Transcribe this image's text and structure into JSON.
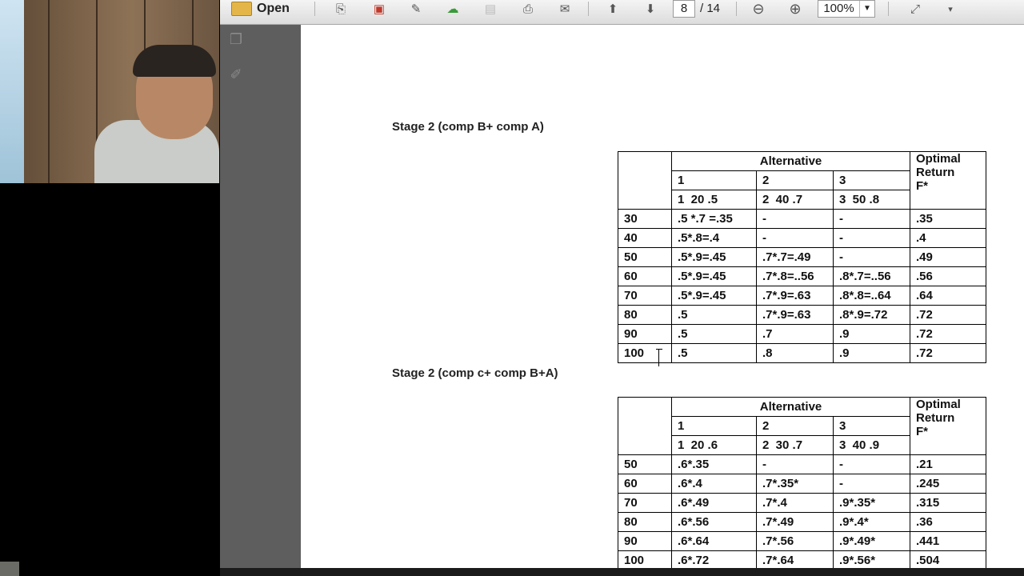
{
  "toolbar": {
    "open_label": "Open",
    "page_current": "8",
    "page_total": "/ 14",
    "zoom": "100%",
    "icons": [
      "create-pdf-icon",
      "export-icon",
      "edit-icon",
      "upload-icon",
      "save-icon",
      "print-icon",
      "email-icon",
      "page-up-icon",
      "page-down-icon",
      "zoom-out-icon",
      "zoom-in-icon",
      "fit-page-icon",
      "more-icon"
    ]
  },
  "document": {
    "stage1_title": "Stage 2 (comp B+ comp A)",
    "stage2_title": "Stage 2 (comp c+ comp B+A)",
    "table1": {
      "alt_header": "Alternative",
      "opt_header": [
        "Optimal",
        "Return",
        "F*"
      ],
      "alt_numbers": [
        "1",
        "2",
        "3"
      ],
      "alt_params": [
        "1  20 .5",
        "2  40 .7",
        "3  50 .8"
      ],
      "rows": [
        {
          "state": "30",
          "a1": ".5 *.7 =.35",
          "a2": "-",
          "a3": "-",
          "opt": ".35"
        },
        {
          "state": "40",
          "a1": ".5*.8=.4",
          "a2": "-",
          "a3": "-",
          "opt": ".4"
        },
        {
          "state": "50",
          "a1": ".5*.9=.45",
          "a2": ".7*.7=.49",
          "a3": "-",
          "opt": ".49"
        },
        {
          "state": "60",
          "a1": ".5*.9=.45",
          "a2": ".7*.8=..56",
          "a3": ".8*.7=..56",
          "opt": ".56"
        },
        {
          "state": "70",
          "a1": ".5*.9=.45",
          "a2": ".7*.9=.63",
          "a3": ".8*.8=..64",
          "opt": ".64"
        },
        {
          "state": "80",
          "a1": ".5",
          "a2": ".7*.9=.63",
          "a3": ".8*.9=.72",
          "opt": ".72"
        },
        {
          "state": "90",
          "a1": ".5",
          "a2": ".7",
          "a3": ".9",
          "opt": ".72"
        },
        {
          "state": "100",
          "a1": ".5",
          "a2": ".8",
          "a3": ".9",
          "opt": ".72"
        }
      ]
    },
    "table2": {
      "alt_header": "Alternative",
      "opt_header": [
        "Optimal",
        "Return",
        "F*"
      ],
      "alt_numbers": [
        "1",
        "2",
        "3"
      ],
      "alt_params": [
        "1  20 .6",
        "2  30 .7",
        "3  40 .9"
      ],
      "rows": [
        {
          "state": "50",
          "a1": ".6*.35",
          "a2": "-",
          "a3": "-",
          "opt": ".21"
        },
        {
          "state": "60",
          "a1": ".6*.4",
          "a2": ".7*.35*",
          "a3": "-",
          "opt": ".245"
        },
        {
          "state": "70",
          "a1": ".6*.49",
          "a2": ".7*.4",
          "a3": ".9*.35*",
          "opt": ".315"
        },
        {
          "state": "80",
          "a1": ".6*.56",
          "a2": ".7*.49",
          "a3": ".9*.4*",
          "opt": ".36"
        },
        {
          "state": "90",
          "a1": ".6*.64",
          "a2": ".7*.56",
          "a3": ".9*.49*",
          "opt": ".441"
        },
        {
          "state": "100",
          "a1": ".6*.72",
          "a2": ".7*.64",
          "a3": ".9*.56*",
          "opt": ".504"
        }
      ]
    }
  }
}
